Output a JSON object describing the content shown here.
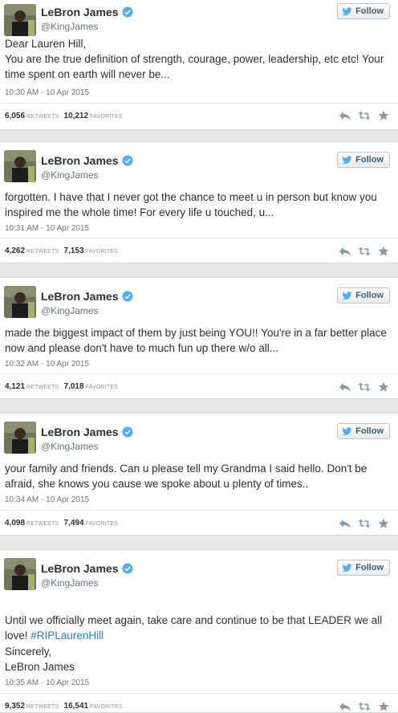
{
  "author": {
    "name": "LeBron James",
    "handle": "@KingJames",
    "follow_label": "Follow"
  },
  "stats_labels": {
    "retweets": "RETWEETS",
    "favorites": "FAVORITES"
  },
  "colors": {
    "hashtag": "#2b7bb9",
    "verified": "#55acee",
    "background": "#e8e8e8"
  },
  "tweets": [
    {
      "text": "Dear Lauren Hill,\nYou are the true definition of strength, courage, power, leadership, etc etc! Your time spent on earth will never be...",
      "timestamp": "10:30 AM - 10 Apr 2015",
      "retweets": "6,056",
      "favorites": "10,212"
    },
    {
      "text": "forgotten. I have that I never got the chance to meet u in person but know you inspired me the whole time! For every life u touched, u...",
      "timestamp": "10:31 AM - 10 Apr 2015",
      "retweets": "4,262",
      "favorites": "7,153"
    },
    {
      "text": "made the biggest impact of them by just being YOU!! You're in a far better place now and please don't have to much fun up there w/o all...",
      "timestamp": "10:32 AM - 10 Apr 2015",
      "retweets": "4,121",
      "favorites": "7,018"
    },
    {
      "text": "your family and friends. Can u please tell my Grandma I said hello. Don't be afraid, she knows you cause we spoke about u plenty of times..",
      "timestamp": "10:34 AM - 10 Apr 2015",
      "retweets": "4,098",
      "favorites": "7,494"
    },
    {
      "text": "Until we officially meet again, take care and continue to be that LEADER we all love! ",
      "hashtag": "#RIPLaurenHill",
      "closing": "Sincerely,\nLeBron James",
      "timestamp": "10:35 AM - 10 Apr 2015",
      "retweets": "9,352",
      "favorites": "16,541"
    }
  ]
}
